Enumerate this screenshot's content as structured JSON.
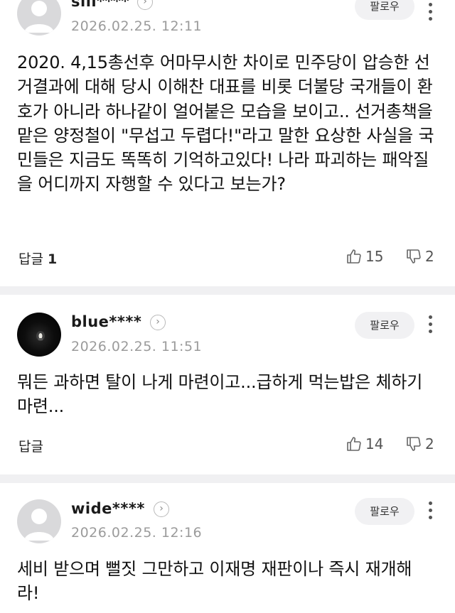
{
  "comments": [
    {
      "username": "sili****",
      "date": "2026.02.25. 12:11",
      "follow_label": "팔로우",
      "body": "2020. 4,15총선후 어마무시한 차이로 민주당이 압승한 선거결과에 대해 당시 이해찬 대표를 비롯 더불당 국개들이 환호가 아니라 하나같이 얼어붙은 모습을 보이고.. 선거총책을 맡은 양정철이 \"무섭고 두렵다!\"라고 말한 요상한 사실을 국민들은 지금도 똑똑히 기억하고있다! 나라 파괴하는 패악질을 어디까지 자행할 수 있다고 보는가?",
      "reply_label": "답글",
      "reply_count": "1",
      "likes": "15",
      "dislikes": "2"
    },
    {
      "username": "blue****",
      "date": "2026.02.25. 11:51",
      "follow_label": "팔로우",
      "body": "뭐든 과하면 탈이 나게 마련이고...급하게 먹는밥은 체하기 마련...",
      "reply_label": "답글",
      "likes": "14",
      "dislikes": "2"
    },
    {
      "username": "wide****",
      "date": "2026.02.25. 12:16",
      "follow_label": "팔로우",
      "body": "세비 받으며 뻘짓 그만하고 이재명 재판이나 즉시 재개해라!"
    }
  ],
  "icons": {
    "chevron": "chevron-right-icon",
    "like": "thumbs-up-icon",
    "dislike": "thumbs-down-icon",
    "more": "more-vertical-icon",
    "avatar_default": "default-avatar-icon"
  },
  "colors": {
    "divider": "#f0f0f2",
    "follow_bg": "#f1f1f3",
    "date_text": "#9b9b9b"
  }
}
